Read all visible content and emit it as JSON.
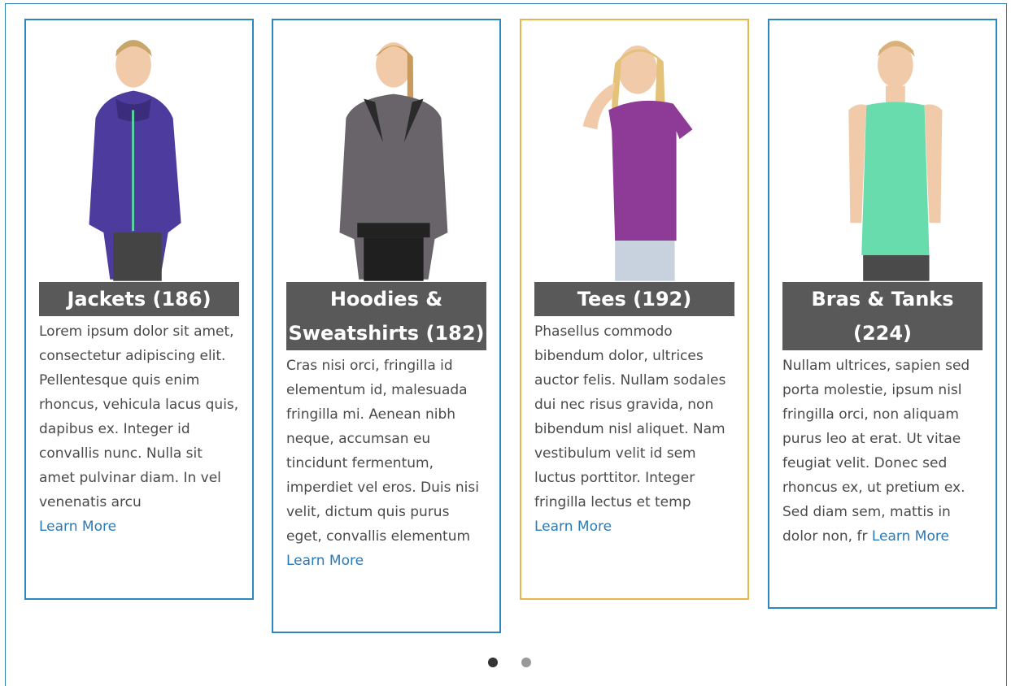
{
  "carousel": {
    "cards": [
      {
        "title": "Jackets (186)",
        "description": "Lorem ipsum dolor sit amet, consectetur adipiscing elit. Pellentesque quis enim rhoncus, vehicula lacus quis, dapibus ex. Integer id convallis nunc. Nulla sit amet pulvinar diam. In vel venenatis arcu",
        "link": "Learn More",
        "image": "woman-purple-jacket"
      },
      {
        "title": "Hoodies & Sweatshirts (182)",
        "description": "Cras nisi orci, fringilla id elementum id, malesuada fringilla mi. Aenean nibh neque, accumsan eu tincidunt fermentum, imperdiet vel eros. Duis nisi velit, dictum quis purus eget, convallis elementum",
        "link": "Learn More",
        "image": "woman-gray-hoodie"
      },
      {
        "title": "Tees (192)",
        "description": "Phasellus commodo bibendum dolor, ultrices auctor felis. Nullam sodales dui nec risus gravida, non bibendum nisl aliquet. Nam vestibulum velit id sem luctus porttitor. Integer fringilla lectus et temp",
        "link": "Learn More",
        "image": "woman-purple-tee"
      },
      {
        "title": "Bras & Tanks (224)",
        "description": "Nullam ultrices, sapien sed porta molestie, ipsum nisl fringilla orci, non aliquam purus leo at erat. Ut vitae feugiat velit. Donec sed rhoncus ex, ut pretium ex. Sed diam sem, mattis in dolor non, fr",
        "link": "Learn More",
        "image": "woman-mint-tank"
      }
    ],
    "pagination": {
      "pages": 2,
      "active": 1
    },
    "colors": {
      "card_border": "#2b87bd",
      "card_border_active": "#e8b64a",
      "title_bg": "#595959",
      "link": "#2b79b5",
      "dot_active": "#333333",
      "dot_inactive": "#999999"
    }
  }
}
